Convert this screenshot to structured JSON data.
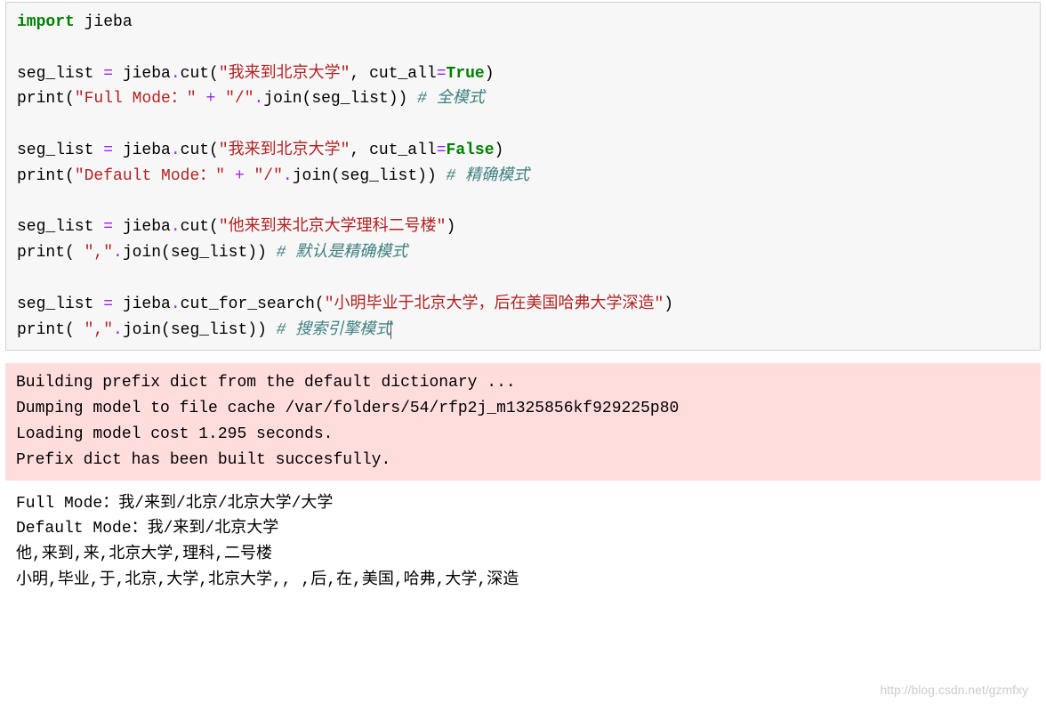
{
  "code": {
    "import_kw": "import",
    "import_mod": "jieba",
    "l3_a": "seg_list ",
    "l3_eq": "=",
    "l3_b": " jieba",
    "l3_dot": ".",
    "l3_c": "cut(",
    "l3_str": "\"我来到北京大学\"",
    "l3_d": ", cut_all",
    "l3_eq2": "=",
    "l3_bool": "True",
    "l3_e": ")",
    "l4_a": "print",
    "l4_b": "(",
    "l4_str": "\"Full Mode：\"",
    "l4_sp": " ",
    "l4_op": "+",
    "l4_sp2": " ",
    "l4_str2": "\"/\"",
    "l4_dot": ".",
    "l4_c": "join(seg_list)) ",
    "l4_cmt": "# 全模式",
    "l6_a": "seg_list ",
    "l6_eq": "=",
    "l6_b": " jieba",
    "l6_dot": ".",
    "l6_c": "cut(",
    "l6_str": "\"我来到北京大学\"",
    "l6_d": ", cut_all",
    "l6_eq2": "=",
    "l6_bool": "False",
    "l6_e": ")",
    "l7_a": "print",
    "l7_b": "(",
    "l7_str": "\"Default Mode：\"",
    "l7_sp": " ",
    "l7_op": "+",
    "l7_sp2": " ",
    "l7_str2": "\"/\"",
    "l7_dot": ".",
    "l7_c": "join(seg_list)) ",
    "l7_cmt": "# 精确模式",
    "l9_a": "seg_list ",
    "l9_eq": "=",
    "l9_b": " jieba",
    "l9_dot": ".",
    "l9_c": "cut(",
    "l9_str": "\"他来到来北京大学理科二号楼\"",
    "l9_e": ")",
    "l10_a": "print",
    "l10_b": "( ",
    "l10_str": "\",\"",
    "l10_dot": ".",
    "l10_c": "join(seg_list)) ",
    "l10_cmt": "# 默认是精确模式",
    "l12_a": "seg_list ",
    "l12_eq": "=",
    "l12_b": " jieba",
    "l12_dot": ".",
    "l12_c": "cut_for_search(",
    "l12_str": "\"小明毕业于北京大学，后在美国哈弗大学深造\"",
    "l12_e": ")",
    "l13_a": "print",
    "l13_b": "( ",
    "l13_str": "\",\"",
    "l13_dot": ".",
    "l13_c": "join(seg_list)) ",
    "l13_cmt": "# 搜索引擎模式"
  },
  "stderr": {
    "l1": "Building prefix dict from the default dictionary ...",
    "l2": "Dumping model to file cache /var/folders/54/rfp2j_m1325856kf929225p80",
    "l3": "Loading model cost 1.295 seconds.",
    "l4": "Prefix dict has been built succesfully."
  },
  "stdout": {
    "l1": "Full Mode：我/来到/北京/北京大学/大学",
    "l2": "Default Mode：我/来到/北京大学",
    "l3": "他,来到,来,北京大学,理科,二号楼",
    "l4": "小明,毕业,于,北京,大学,北京大学,, ,后,在,美国,哈弗,大学,深造"
  },
  "watermark": "http://blog.csdn.net/gzmfxy"
}
